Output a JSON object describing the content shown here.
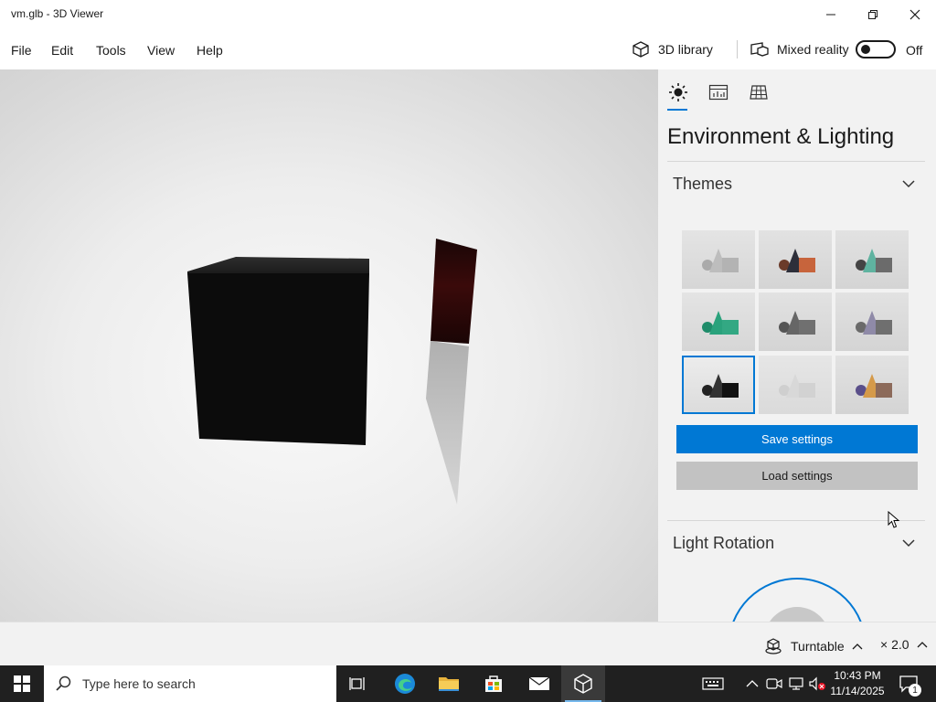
{
  "window": {
    "title": "vm.glb - 3D Viewer"
  },
  "menu": {
    "file": "File",
    "edit": "Edit",
    "tools": "Tools",
    "view": "View",
    "help": "Help"
  },
  "toolbar": {
    "library": "3D library",
    "mixed_reality": "Mixed reality",
    "toggle_state": "Off"
  },
  "panel": {
    "title": "Environment & Lighting",
    "tabs": [
      "lighting-icon",
      "stats-icon",
      "grid-icon"
    ],
    "themes_section": "Themes",
    "save_button": "Save settings",
    "load_button": "Load settings",
    "light_rotation_section": "Light Rotation",
    "selected_theme_index": 6
  },
  "status": {
    "mode": "Turntable",
    "speed": "× 2.0"
  },
  "taskbar": {
    "search_placeholder": "Type here to search",
    "time": "10:43 PM",
    "date": "11/14/2025",
    "notifications": "1"
  },
  "colors": {
    "accent": "#0078d4",
    "taskbar": "#202020",
    "panel": "#f2f2f2"
  }
}
